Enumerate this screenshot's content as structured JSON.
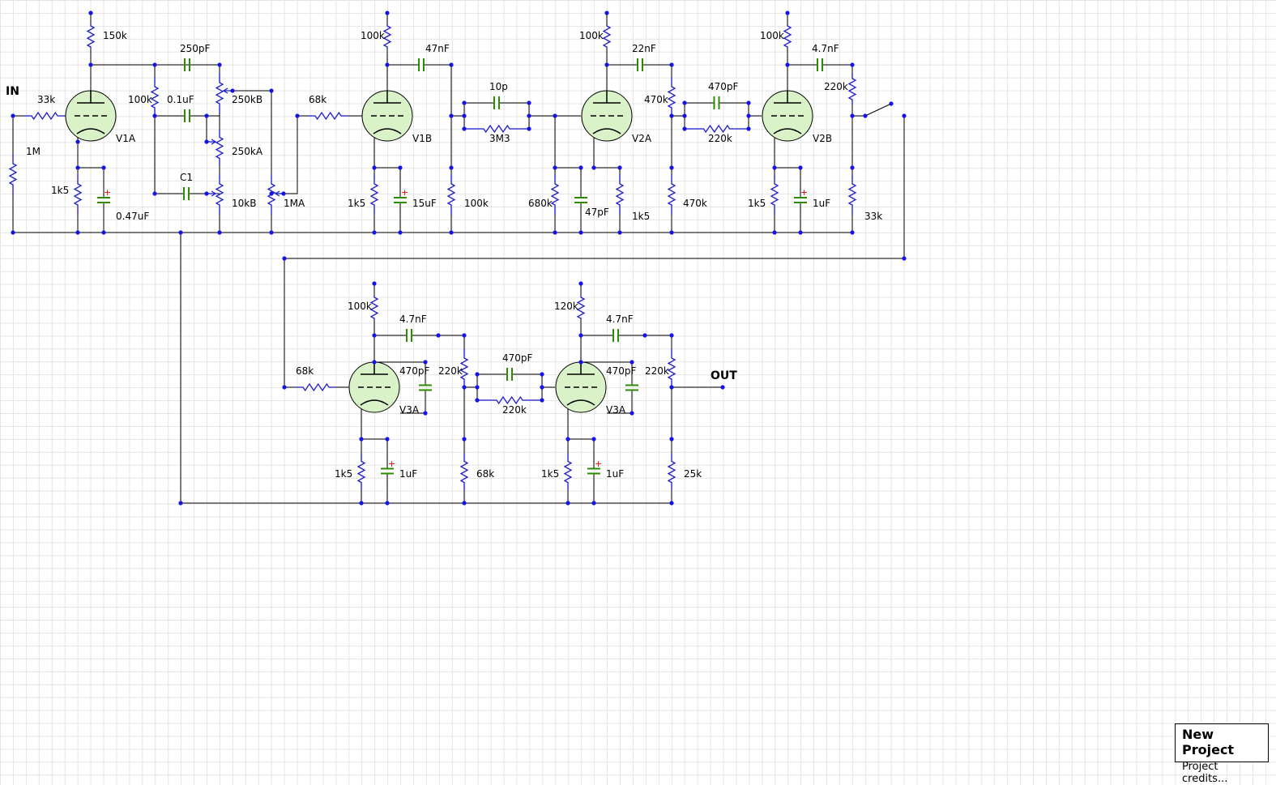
{
  "io": {
    "input": "IN",
    "output": "OUT"
  },
  "title_block": {
    "name": "New Project",
    "credits": "Project credits..."
  },
  "colors": {
    "wire": "#000000",
    "resistor": "#1b1bd0",
    "capacitor": "#2e8b00",
    "node": "#1414e6",
    "tube": "#d9f2c8",
    "polarity": "#e00000"
  },
  "tubes": [
    "V1A",
    "V1B",
    "V2A",
    "V2B",
    "V3A",
    "V3A"
  ],
  "labels": {
    "r_150k": "150k",
    "c_250pF": "250pF",
    "r_33k_in": "33k",
    "r_100k_a": "100k",
    "c_01uF": "0.1uF",
    "pot_250kB": "250kB",
    "pot_250kA": "250kA",
    "pot_10kB": "10kB",
    "c_C1": "C1",
    "r_1M": "1M",
    "r_1k5_a": "1k5",
    "c_047uF": "0.47uF",
    "r_68k_a": "68k",
    "pot_1MA": "1MA",
    "r_100k_b": "100k",
    "c_47nF": "47nF",
    "r_1k5_b": "1k5",
    "c_15uF": "15uF",
    "r_100k_c": "100k",
    "c_10p": "10p",
    "r_3M3": "3M3",
    "r_100k_d": "100k",
    "c_22nF": "22nF",
    "r_470k_a": "470k",
    "r_680k": "680k",
    "c_47pF": "47pF",
    "r_1k5_c": "1k5",
    "r_470k_b": "470k",
    "c_470pF_a": "470pF",
    "r_220k_a": "220k",
    "r_100k_e": "100k",
    "c_47nF_b": "4.7nF",
    "r_220k_b": "220k",
    "r_1k5_d": "1k5",
    "c_1uF_a": "1uF",
    "r_33k_b": "33k",
    "r_100k_f": "100k",
    "c_47nF_c": "4.7nF",
    "c_470pF_b": "470pF",
    "r_68k_b": "68k",
    "r_220k_c": "220k",
    "c_470pF_c": "470pF",
    "r_220k_d": "220k",
    "r_68k_c": "68k",
    "r_1k5_e": "1k5",
    "c_1uF_b": "1uF",
    "r_120k": "120k",
    "c_47nF_d": "4.7nF",
    "c_470pF_d": "470pF",
    "r_220k_e": "220k",
    "r_1k5_f": "1k5",
    "c_1uF_c": "1uF",
    "r_25k": "25k"
  }
}
